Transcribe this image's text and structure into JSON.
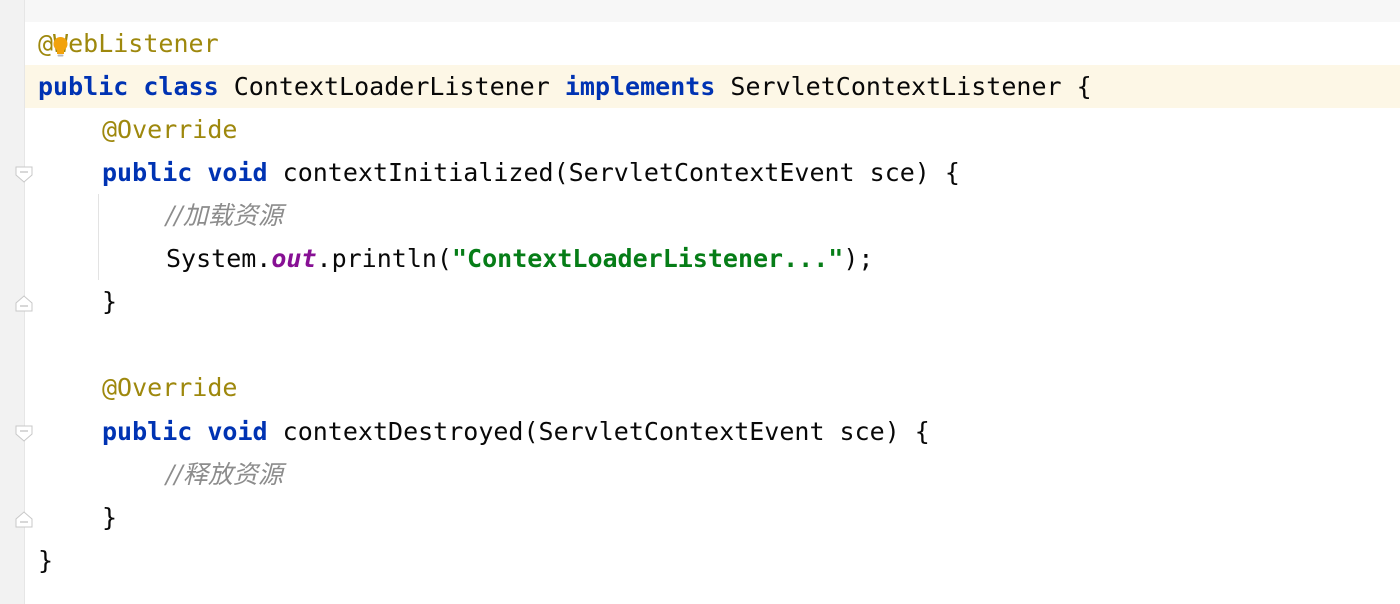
{
  "editor": {
    "lines": {
      "l1": {
        "annotation": "@WebListener"
      },
      "l2": {
        "kw1": "public",
        "kw2": "class",
        "class_name": "ContextLoaderListener",
        "kw3": "implements",
        "interface": "ServletContextListener",
        "brace": "{"
      },
      "l3": {
        "annotation": "@Override"
      },
      "l4": {
        "kw1": "public",
        "kw2": "void",
        "signature": "contextInitialized(ServletContextEvent sce) {"
      },
      "l5": {
        "comment": "//加载资源"
      },
      "l6": {
        "prefix": "System.",
        "field": "out",
        "call": ".println(",
        "string": "\"ContextLoaderListener...\"",
        "suffix": ");"
      },
      "l7": {
        "brace": "}"
      },
      "l9": {
        "annotation": "@Override"
      },
      "l10": {
        "kw1": "public",
        "kw2": "void",
        "signature": "contextDestroyed(ServletContextEvent sce) {"
      },
      "l11": {
        "comment": "//释放资源"
      },
      "l12": {
        "brace": "}"
      },
      "l13": {
        "brace": "}"
      }
    },
    "colors": {
      "keyword": "#0033b3",
      "annotation": "#9e880d",
      "comment": "#8c8c8c",
      "string": "#067d17",
      "static_field": "#871094",
      "current_line": "#fdf7e6"
    },
    "icons": {
      "intention": "lightbulb-icon",
      "fold_open": "fold-open-icon",
      "fold_close": "fold-close-icon"
    }
  }
}
